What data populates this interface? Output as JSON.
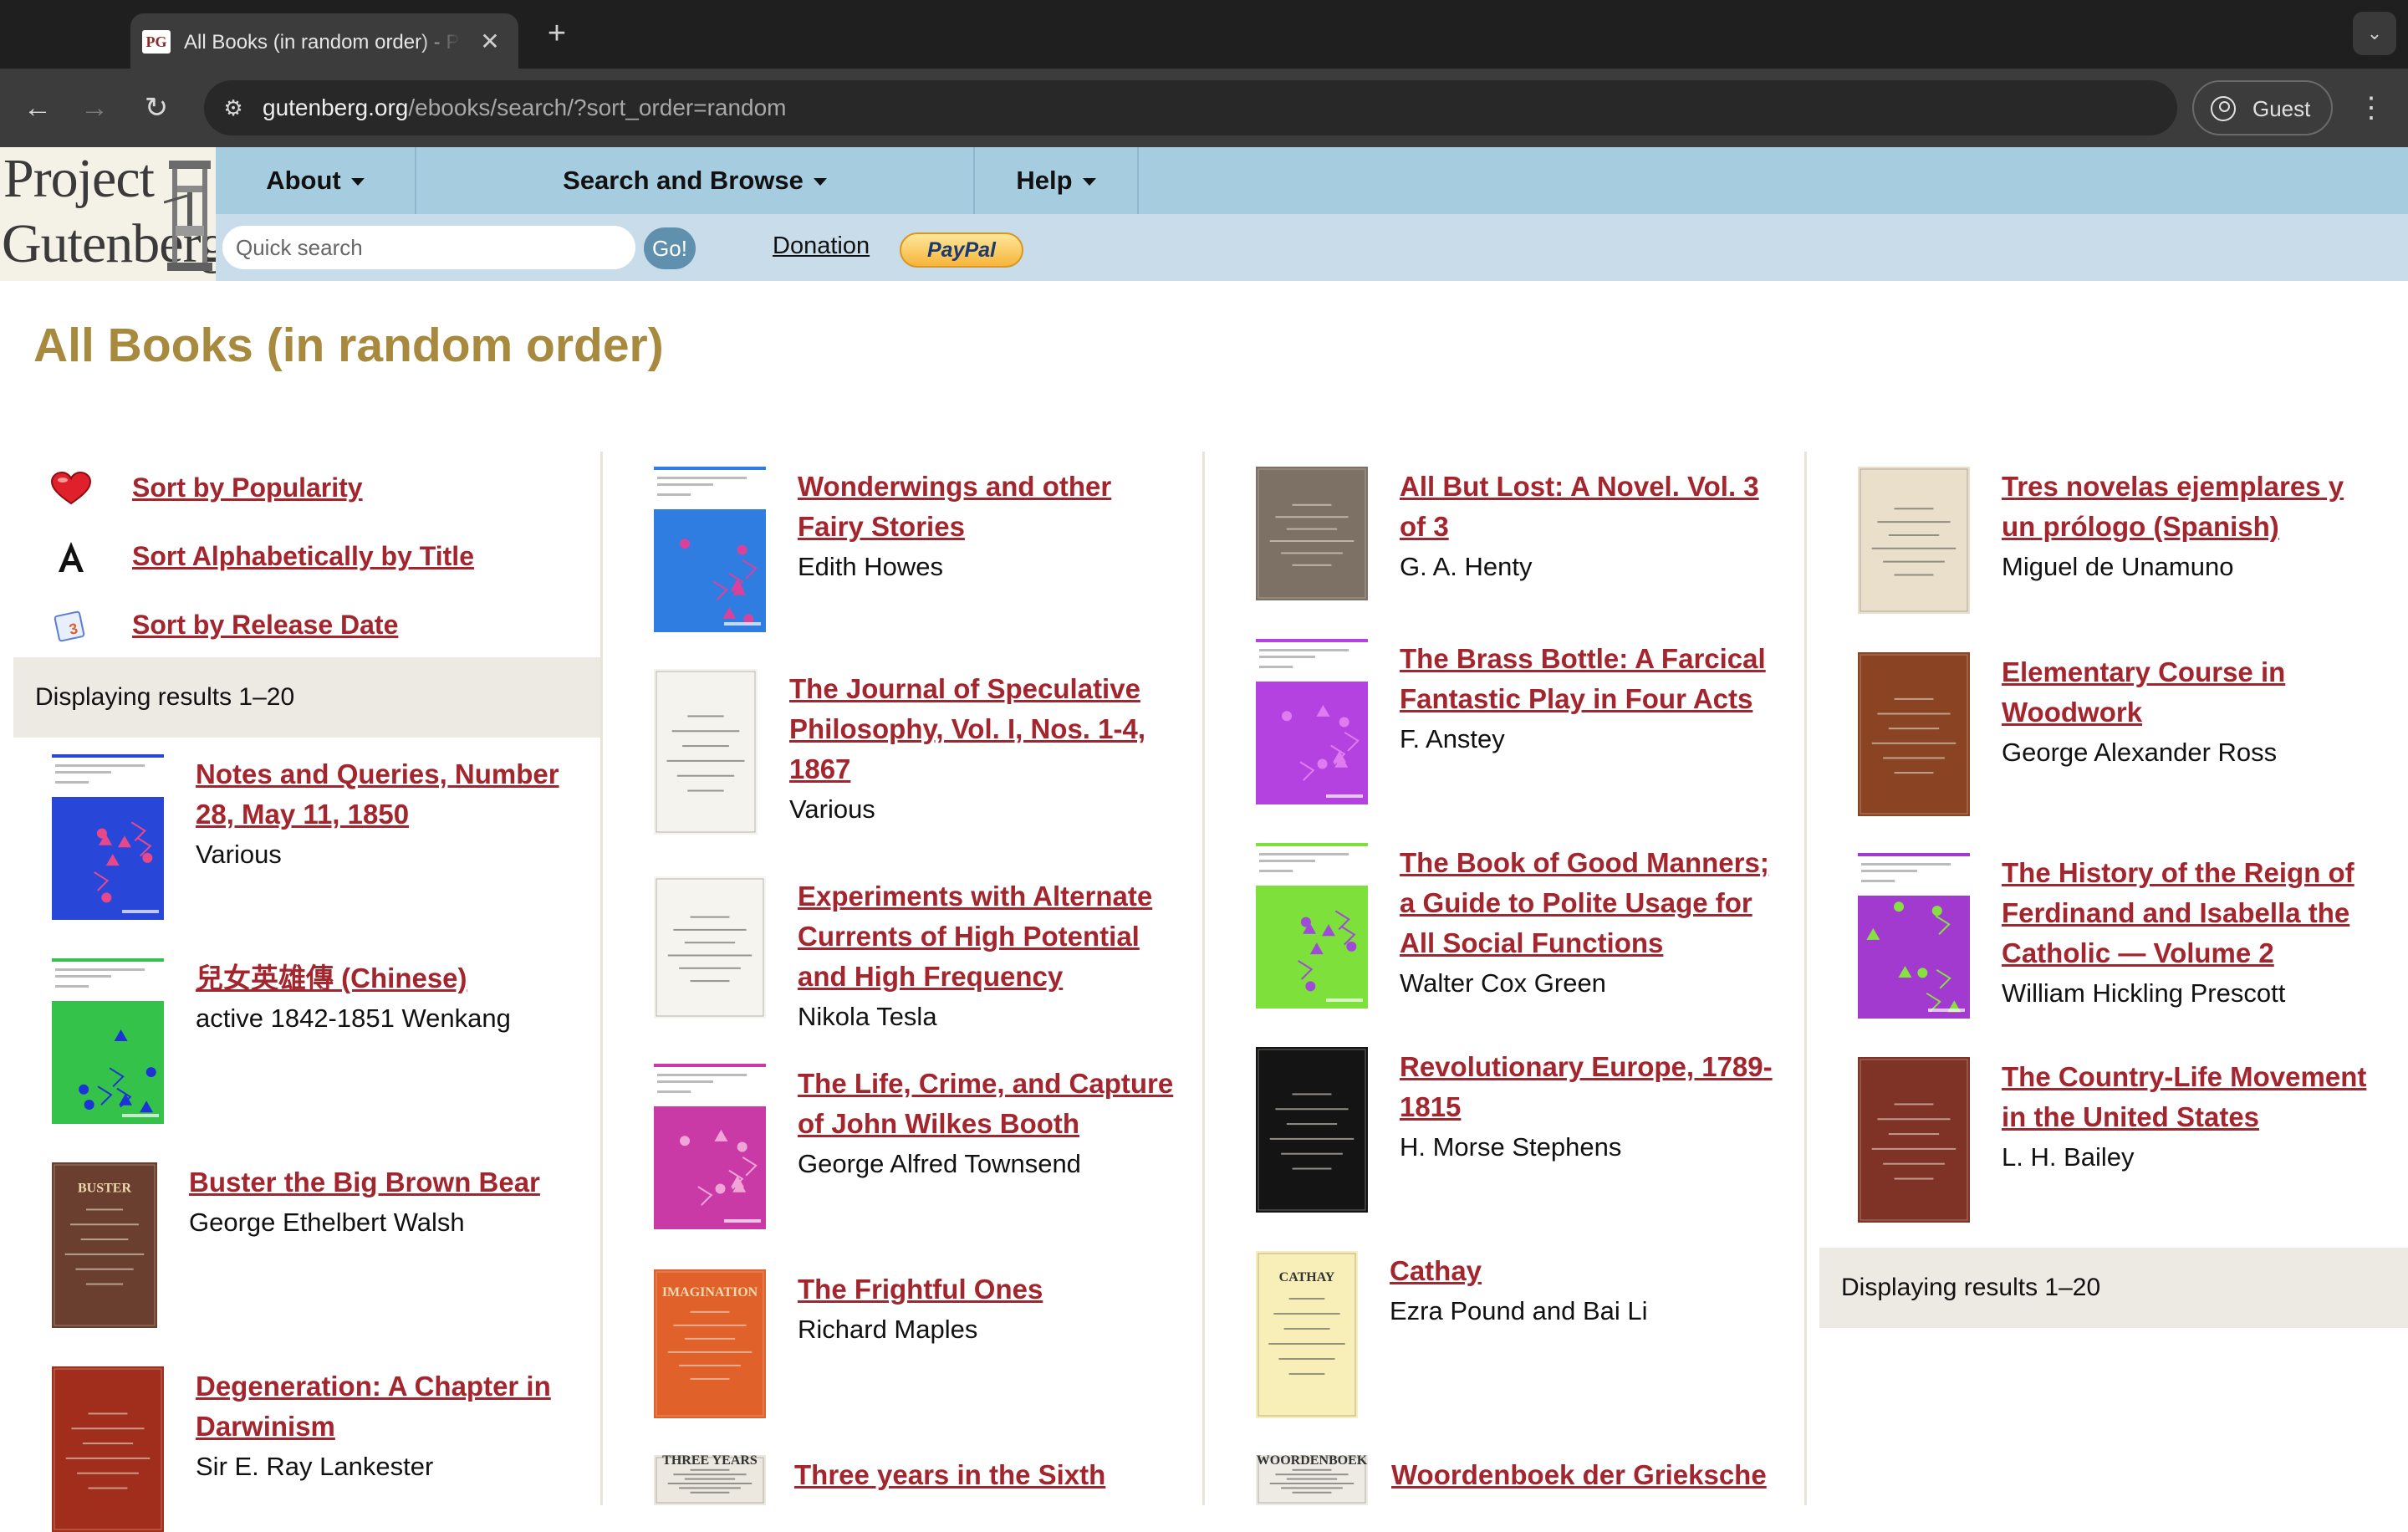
{
  "browser": {
    "tab_title": "All Books (in random order) - Project Gutenberg",
    "tab_favicon": "PG",
    "new_tab_icon": "+",
    "url_host": "gutenberg.org",
    "url_path": "/ebooks/search/?sort_order=random",
    "profile_label": "Guest"
  },
  "site": {
    "logo_line1": "Project",
    "logo_line2": "Gutenberg",
    "menu": [
      {
        "label": "About"
      },
      {
        "label": "Search and Browse"
      },
      {
        "label": "Help"
      }
    ],
    "search_placeholder": "Quick search",
    "go_label": "Go!",
    "donation_label": "Donation",
    "paypal_label": "PayPal"
  },
  "page": {
    "title": "All Books (in random order)",
    "sort_options": [
      {
        "label": "Sort by Popularity",
        "icon": "heart-icon"
      },
      {
        "label": "Sort Alphabetically by Title",
        "icon": "letter-a-icon"
      },
      {
        "label": "Sort by Release Date",
        "icon": "calendar-icon"
      }
    ],
    "results_text": "Displaying results 1–20",
    "results_text_bottom": "Displaying results 1–20"
  },
  "books": [
    {
      "title_lines": [
        "Notes and Queries, Number",
        "28, May 11, 1850"
      ],
      "author": "Various",
      "cover": "generated",
      "cover_color": "#2847d8",
      "accent": "#e8488a"
    },
    {
      "title_lines": [
        "兒女英雄傳 (Chinese)"
      ],
      "author": "active 1842-1851 Wenkang",
      "cover": "generated",
      "cover_color": "#35c24a",
      "accent": "#1c34d6"
    },
    {
      "title_lines": [
        "Buster the Big Brown Bear"
      ],
      "author": "George Ethelbert Walsh",
      "cover": "scan",
      "cover_color": "#6b3f2f",
      "cover_text": "BUSTER"
    },
    {
      "title_lines": [
        "Degeneration: A Chapter in",
        "Darwinism"
      ],
      "author": "Sir E. Ray Lankester",
      "cover": "scan",
      "cover_color": "#a12e1c"
    },
    {
      "title_lines": [
        "Wonderwings and other",
        "Fairy Stories"
      ],
      "author": "Edith Howes",
      "cover": "generated",
      "cover_color": "#2f7de0",
      "accent": "#d8429c"
    },
    {
      "title_lines": [
        "The Journal of Speculative",
        "Philosophy, Vol. I, Nos. 1-4,",
        "1867"
      ],
      "author": "Various",
      "cover": "scan",
      "cover_color": "#f5f3ee"
    },
    {
      "title_lines": [
        "Experiments with Alternate",
        "Currents of High Potential",
        "and High Frequency"
      ],
      "author": "Nikola Tesla",
      "cover": "scan",
      "cover_color": "#f6f4ef"
    },
    {
      "title_lines": [
        "The Life, Crime, and Capture",
        "of John Wilkes Booth"
      ],
      "author": "George Alfred Townsend",
      "cover": "generated",
      "cover_color": "#c93aa6",
      "accent": "#f0a4d8"
    },
    {
      "title_lines": [
        "The Frightful Ones"
      ],
      "author": "Richard Maples",
      "cover": "scan",
      "cover_color": "#e0622a",
      "cover_text": "IMAGINATION"
    },
    {
      "title_lines": [
        "Three years in the Sixth"
      ],
      "author": "",
      "cover": "scan",
      "cover_color": "#ece8df",
      "cover_text": "THREE YEARS"
    },
    {
      "title_lines": [
        "All But Lost: A Novel. Vol. 3",
        "of 3"
      ],
      "author": "G. A. Henty",
      "cover": "scan",
      "cover_color": "#7c7164"
    },
    {
      "title_lines": [
        "The Brass Bottle: A Farcical",
        "Fantastic Play in Four Acts"
      ],
      "author": "F. Anstey",
      "cover": "generated",
      "cover_color": "#b442e0",
      "accent": "#e07cf0"
    },
    {
      "title_lines": [
        "The Book of Good Manners;",
        "a Guide to Polite Usage for",
        "All Social Functions"
      ],
      "author": "Walter Cox Green",
      "cover": "generated",
      "cover_color": "#7ee03a",
      "accent": "#a04ad8"
    },
    {
      "title_lines": [
        "Revolutionary Europe, 1789-",
        "1815"
      ],
      "author": "H. Morse Stephens",
      "cover": "scan",
      "cover_color": "#141414"
    },
    {
      "title_lines": [
        "Cathay"
      ],
      "author": "Ezra Pound and Bai Li",
      "cover": "scan",
      "cover_color": "#f8efb8",
      "cover_text": "CATHAY"
    },
    {
      "title_lines": [
        "Woordenboek der Grieksche"
      ],
      "author": "",
      "cover": "scan",
      "cover_color": "#eeebe4",
      "cover_text": "WOORDENBOEK"
    },
    {
      "title_lines": [
        "Tres novelas ejemplares y",
        "un prólogo (Spanish)"
      ],
      "author": "Miguel de Unamuno",
      "cover": "scan",
      "cover_color": "#e9dfcb"
    },
    {
      "title_lines": [
        "Elementary Course in",
        "Woodwork"
      ],
      "author": "George Alexander Ross",
      "cover": "scan",
      "cover_color": "#8a4424"
    },
    {
      "title_lines": [
        "The History of the Reign of",
        "Ferdinand and Isabella the",
        "Catholic — Volume 2"
      ],
      "author": "William Hickling Prescott",
      "cover": "generated",
      "cover_color": "#a23ad0",
      "accent": "#86e040"
    },
    {
      "title_lines": [
        "The Country-Life Movement",
        "in the United States"
      ],
      "author": "L. H. Bailey",
      "cover": "scan",
      "cover_color": "#7e3326"
    }
  ]
}
